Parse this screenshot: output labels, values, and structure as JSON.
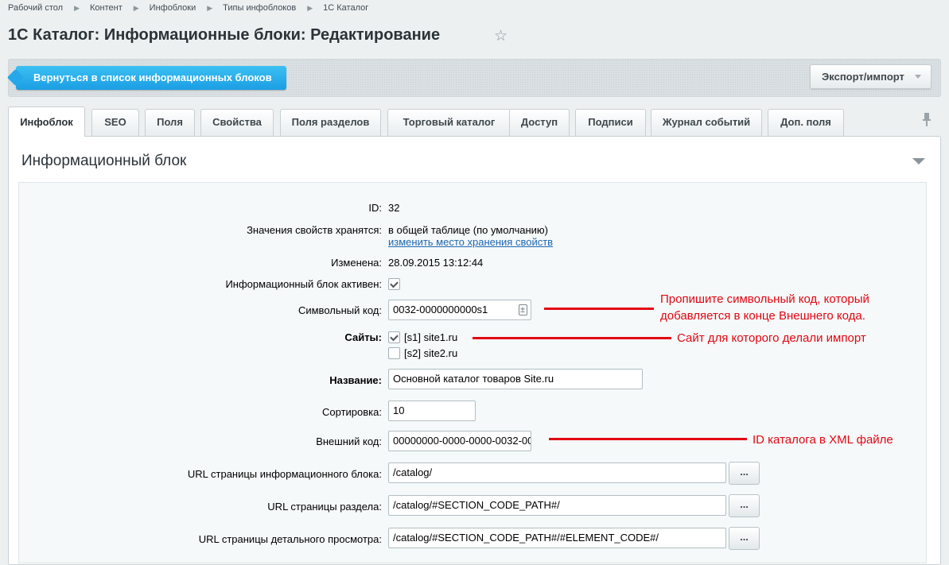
{
  "breadcrumb": [
    "Рабочий стол",
    "Контент",
    "Инфоблоки",
    "Типы инфоблоков",
    "1С Каталог"
  ],
  "page_title": "1С Каталог: Информационные блоки: Редактирование",
  "toolbar": {
    "back_label": "Вернуться в список информационных блоков",
    "export_label": "Экспорт/импорт"
  },
  "tabs": [
    "Инфоблок",
    "SEO",
    "Поля",
    "Свойства",
    "Поля разделов",
    "Торговый каталог",
    "Доступ",
    "Подписи",
    "Журнал событий",
    "Доп. поля"
  ],
  "active_tab": "Инфоблок",
  "section_title": "Информационный блок",
  "form": {
    "id_label": "ID:",
    "id_value": "32",
    "storage_label": "Значения свойств хранятся:",
    "storage_value": "в общей таблице (по умолчанию)",
    "storage_link": "изменить место хранения свойств",
    "modified_label": "Изменена:",
    "modified_value": "28.09.2015 13:12:44",
    "active_label": "Информационный блок активен:",
    "active_checked": true,
    "code_label": "Символьный код:",
    "code_value": "0032-0000000000s1",
    "sites_label": "Сайты:",
    "sites": [
      {
        "label": "[s1] site1.ru",
        "checked": true
      },
      {
        "label": "[s2] site2.ru",
        "checked": false
      }
    ],
    "name_label": "Название:",
    "name_value": "Основной каталог товаров Site.ru",
    "sort_label": "Сортировка:",
    "sort_value": "10",
    "xml_label": "Внешний код:",
    "xml_value": "00000000-0000-0000-0032-00",
    "url_list_label": "URL страницы информационного блока:",
    "url_list_value": "/catalog/",
    "url_section_label": "URL страницы раздела:",
    "url_section_value": "/catalog/#SECTION_CODE_PATH#/",
    "url_detail_label": "URL страницы детального просмотра:",
    "url_detail_value": "/catalog/#SECTION_CODE_PATH#/#ELEMENT_CODE#/",
    "browse_label": "..."
  },
  "annotations": {
    "code_note_line1": "Пропишите символьный код, который",
    "code_note_line2": "добавляется в конце Внешнего кода.",
    "site_note": "Сайт для которого делали импорт",
    "xml_note": "ID каталога в XML файле",
    "color": "#e30613"
  }
}
